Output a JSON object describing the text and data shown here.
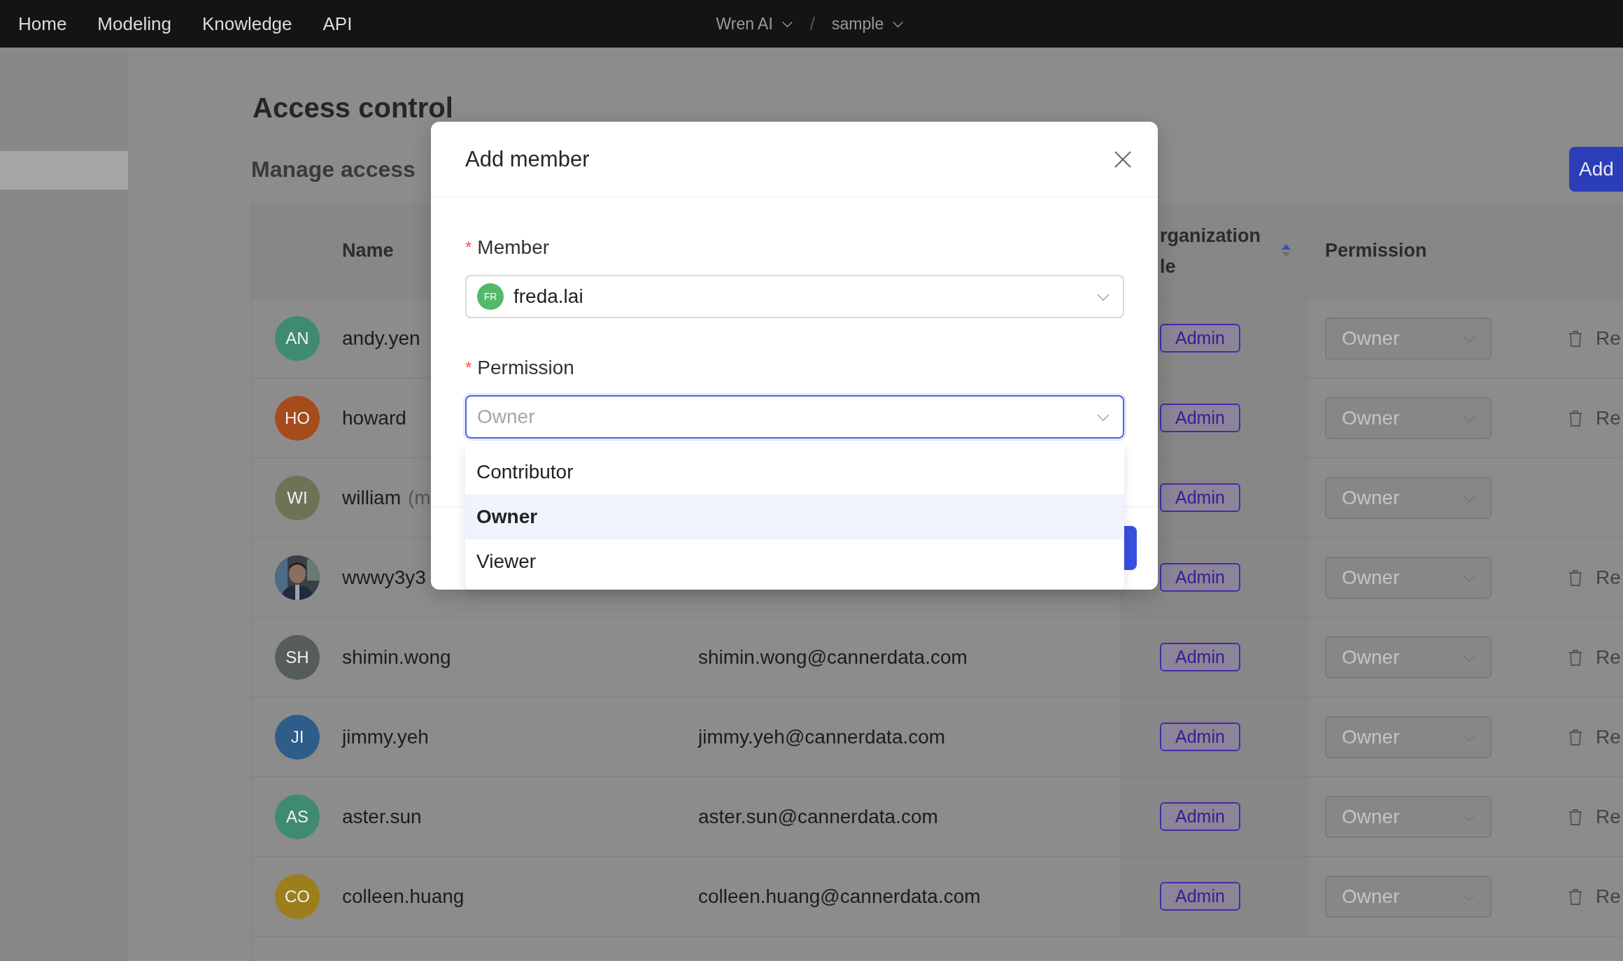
{
  "nav": {
    "links": [
      {
        "label": "Home"
      },
      {
        "label": "Modeling"
      },
      {
        "label": "Knowledge"
      },
      {
        "label": "API"
      }
    ],
    "breadcrumb": [
      {
        "label": "Wren AI"
      },
      {
        "label": "sample"
      }
    ],
    "separator": "/"
  },
  "page": {
    "title": "Access control",
    "section_title": "Manage access",
    "add_button": "Add"
  },
  "table": {
    "headers": {
      "name": "Name",
      "role": "rganization le",
      "role_sort_ascending": true,
      "permission": "Permission"
    },
    "rows": [
      {
        "avatar": {
          "kind": "initials",
          "initials": "AN",
          "color": "#3f8a72"
        },
        "name": "andy.yen",
        "role": "Admin",
        "permission": {
          "value": "Owner",
          "disabled": true
        },
        "remove": "Re"
      },
      {
        "avatar": {
          "kind": "initials",
          "initials": "HO",
          "color": "#a64b1c"
        },
        "name": "howard",
        "role": "Admin",
        "permission": {
          "value": "Owner",
          "disabled": true
        },
        "remove": "Re"
      },
      {
        "avatar": {
          "kind": "initials",
          "initials": "WI",
          "color": "#6e7358"
        },
        "name": "william",
        "note": "(m",
        "role": "Admin",
        "permission": {
          "value": "Owner",
          "disabled": true
        }
      },
      {
        "name": "wwwy3y3",
        "role": "Admin",
        "permission": {
          "value": "Owner",
          "disabled": true
        },
        "remove": "Re"
      },
      {
        "avatar": {
          "kind": "initials",
          "initials": "SH",
          "color": "#555c5a"
        },
        "name": "shimin.wong",
        "email": "shimin.wong@cannerdata.com",
        "role": "Admin",
        "permission": {
          "value": "Owner",
          "disabled": true
        },
        "remove": "Re"
      },
      {
        "avatar": {
          "kind": "initials",
          "initials": "JI",
          "color": "#2e5d8a"
        },
        "name": "jimmy.yeh",
        "email": "jimmy.yeh@cannerdata.com",
        "role": "Admin",
        "permission": {
          "value": "Owner",
          "disabled": true
        },
        "remove": "Re"
      },
      {
        "avatar": {
          "kind": "initials",
          "initials": "AS",
          "color": "#3f8a72"
        },
        "name": "aster.sun",
        "email": "aster.sun@cannerdata.com",
        "role": "Admin",
        "permission": {
          "value": "Owner",
          "disabled": true
        },
        "remove": "Re"
      },
      {
        "avatar": {
          "kind": "initials",
          "initials": "CO",
          "color": "#9c7e1c"
        },
        "name": "colleen.huang",
        "email": "colleen.huang@cannerdata.com",
        "role": "Admin",
        "permission": {
          "value": "Owner",
          "disabled": true
        },
        "remove": "Re"
      }
    ]
  },
  "modal": {
    "title": "Add member",
    "fields": [
      {
        "label": "Member",
        "required_mark": "*",
        "value": "freda.lai",
        "avatar": {
          "initials": "FR",
          "color": "#52b86a"
        },
        "focused": false
      },
      {
        "label": "Permission",
        "required_mark": "*",
        "placeholder": "Owner",
        "focused": true,
        "open": true,
        "options": [
          {
            "label": "Contributor",
            "selected": false
          },
          {
            "label": "Owner",
            "selected": true
          },
          {
            "label": "Viewer",
            "selected": false
          }
        ]
      }
    ]
  }
}
